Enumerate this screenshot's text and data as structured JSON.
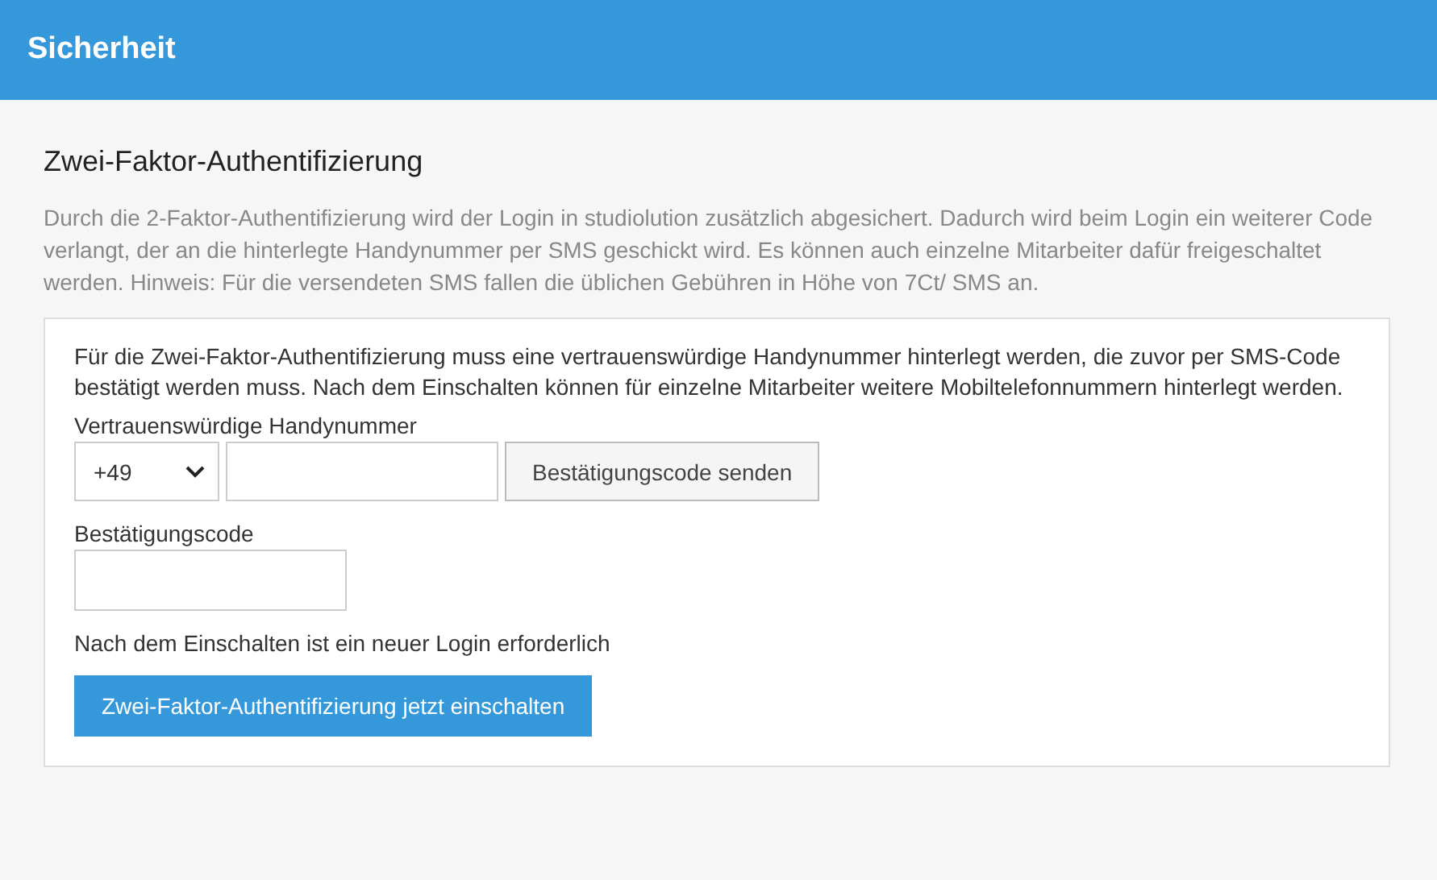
{
  "header": {
    "title": "Sicherheit"
  },
  "section": {
    "title": "Zwei-Faktor-Authentifizierung",
    "description": "Durch die 2-Faktor-Authentifizierung wird der Login in studiolution zusätzlich abgesichert. Dadurch wird beim Login ein weiterer Code verlangt, der an die hinterlegte Handynummer per SMS geschickt wird. Es können auch einzelne Mitarbeiter dafür freigeschaltet werden. Hinweis: Für die versendeten SMS fallen die üblichen Gebühren in Höhe von 7Ct/ SMS an."
  },
  "card": {
    "intro": "Für die Zwei-Faktor-Authentifizierung muss eine vertrauenswürdige Handynummer hinterlegt werden, die zuvor per SMS-Code bestätigt werden muss. Nach dem Einschalten können für einzelne Mitarbeiter weitere Mobiltelefonnummern hinterlegt werden.",
    "phone_label": "Vertrauenswürdige Handynummer",
    "country_code": "+49",
    "send_button": "Bestätigungscode senden",
    "code_label": "Bestätigungscode",
    "note": "Nach dem Einschalten ist ein neuer Login erforderlich",
    "enable_button": "Zwei-Faktor-Authentifizierung jetzt einschalten"
  }
}
